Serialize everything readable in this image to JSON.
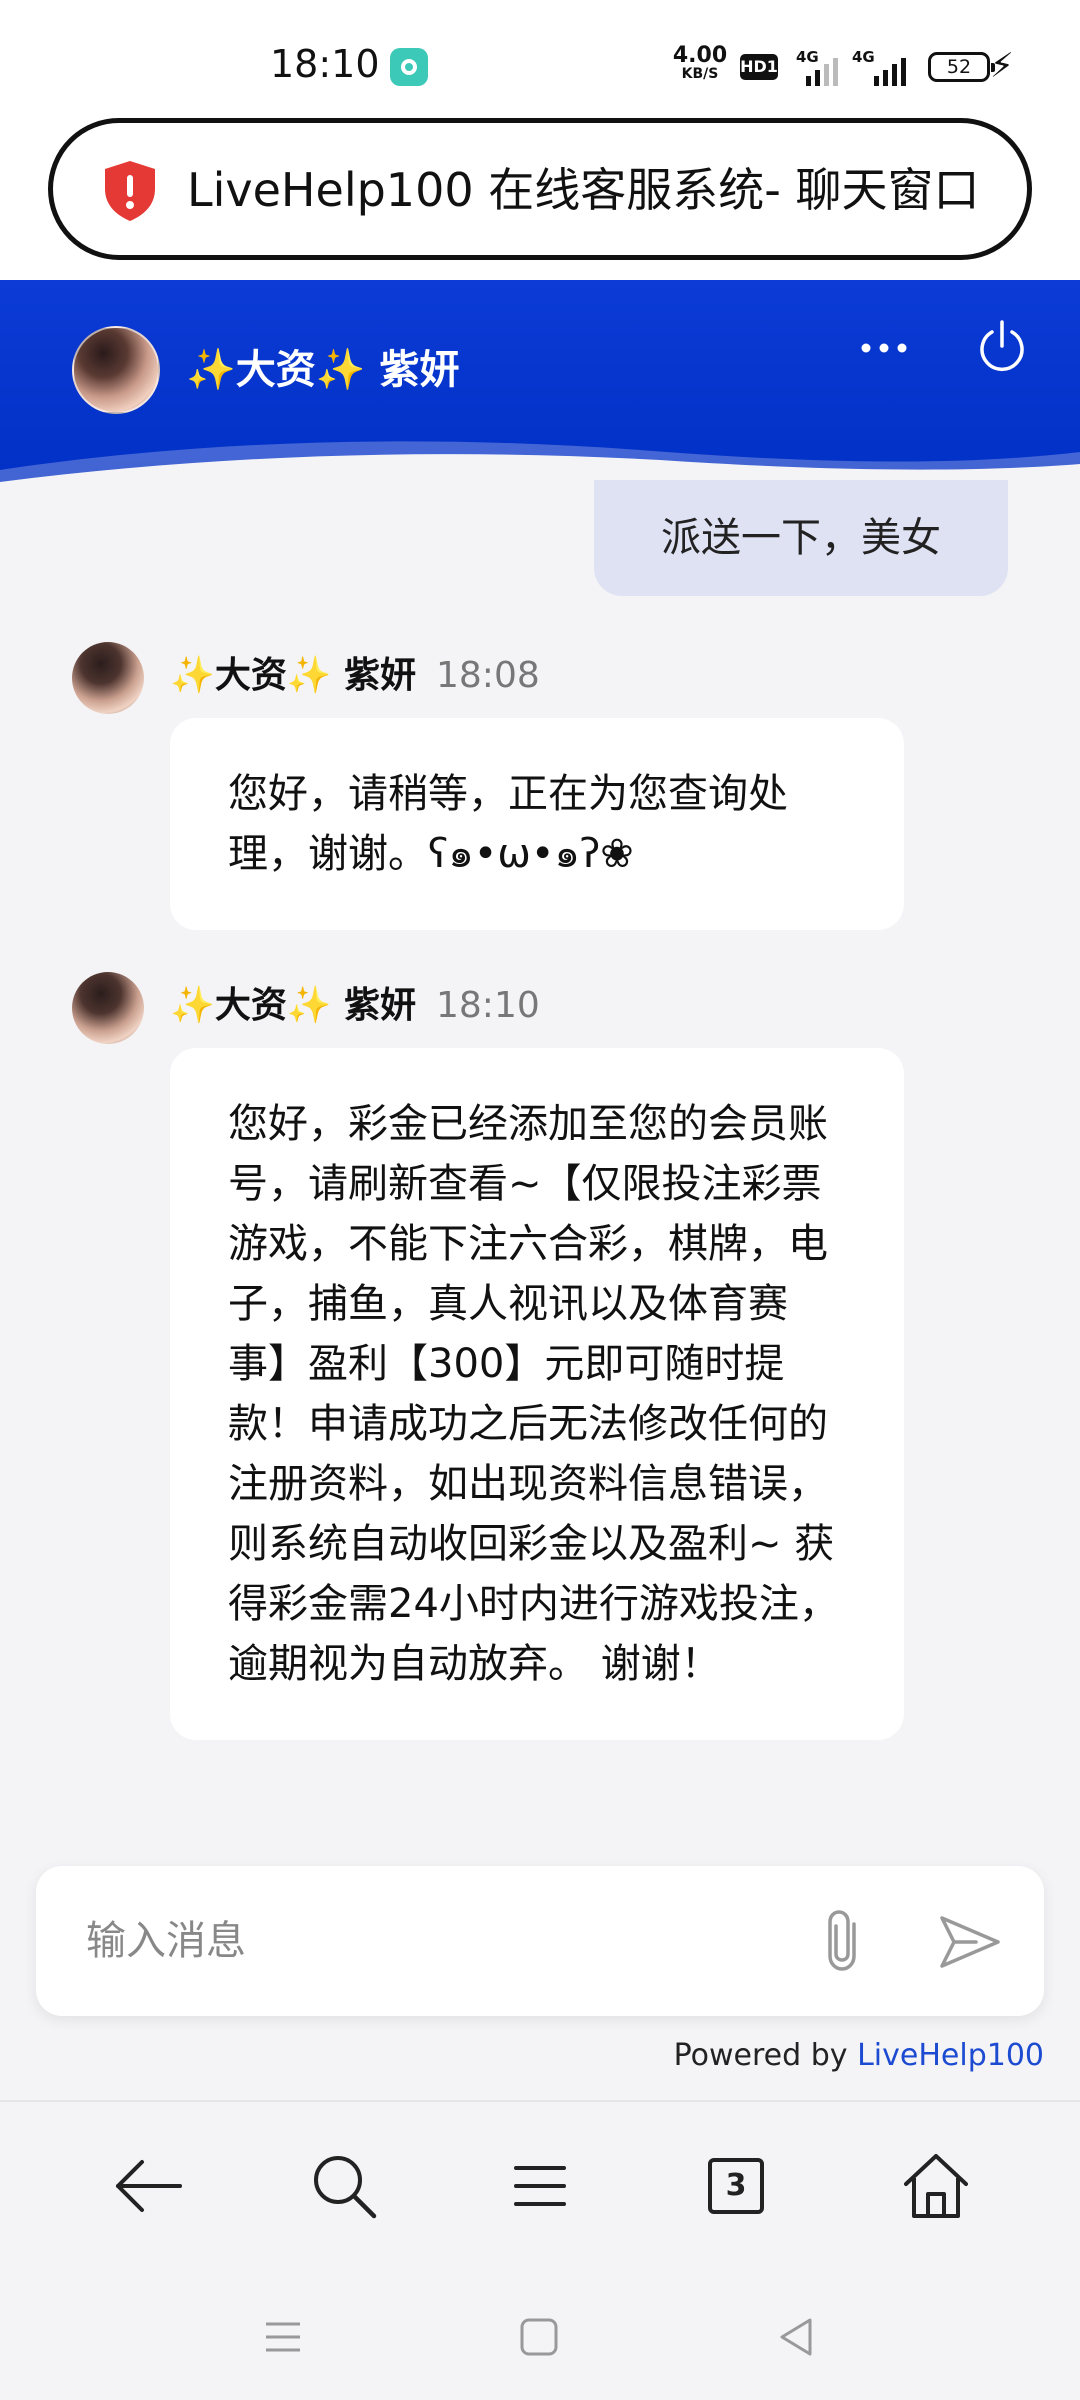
{
  "status_bar": {
    "time": "18:10",
    "net_speed_value": "4.00",
    "net_speed_unit": "KB/S",
    "hd_label": "HD1",
    "sim1_tag": "4G",
    "sim2_tag": "4G",
    "battery": "52"
  },
  "url_bar": {
    "title": "LiveHelp100 在线客服系统- 聊天窗口",
    "shield_color": "#e53935"
  },
  "header": {
    "agent_name": "✨大资✨ 紫妍",
    "background_color": "#0030c4"
  },
  "chat": {
    "self_message": "派送一下，美女",
    "messages": [
      {
        "sender": "✨大资✨ 紫妍",
        "time": "18:08",
        "text": "您好，请稍等，正在为您查询处理，谢谢。ʕ๑•ω•๑ʔ❀"
      },
      {
        "sender": "✨大资✨ 紫妍",
        "time": "18:10",
        "text": "您好，彩金已经添加至您的会员账号，请刷新查看~【仅限投注彩票游戏，不能下注六合彩，棋牌，电子，捕鱼，真人视讯以及体育赛事】盈利【300】元即可随时提款！申请成功之后无法修改任何的注册资料，如出现资料信息错误，则系统自动收回彩金以及盈利~ 获得彩金需24小时内进行游戏投注，逾期视为自动放弃。 谢谢！"
      }
    ]
  },
  "input": {
    "placeholder": "输入消息",
    "value": ""
  },
  "footer": {
    "powered_by": "Powered by",
    "brand": "LiveHelp100",
    "brand_color": "#1c4bd1"
  },
  "browser_nav": {
    "tabs_count": "3",
    "icons": [
      "back-icon",
      "search-icon",
      "menu-icon",
      "tabs-icon",
      "home-icon"
    ]
  },
  "system_nav": {
    "icons": [
      "recents-icon",
      "home-square-icon",
      "back-triangle-icon"
    ]
  }
}
